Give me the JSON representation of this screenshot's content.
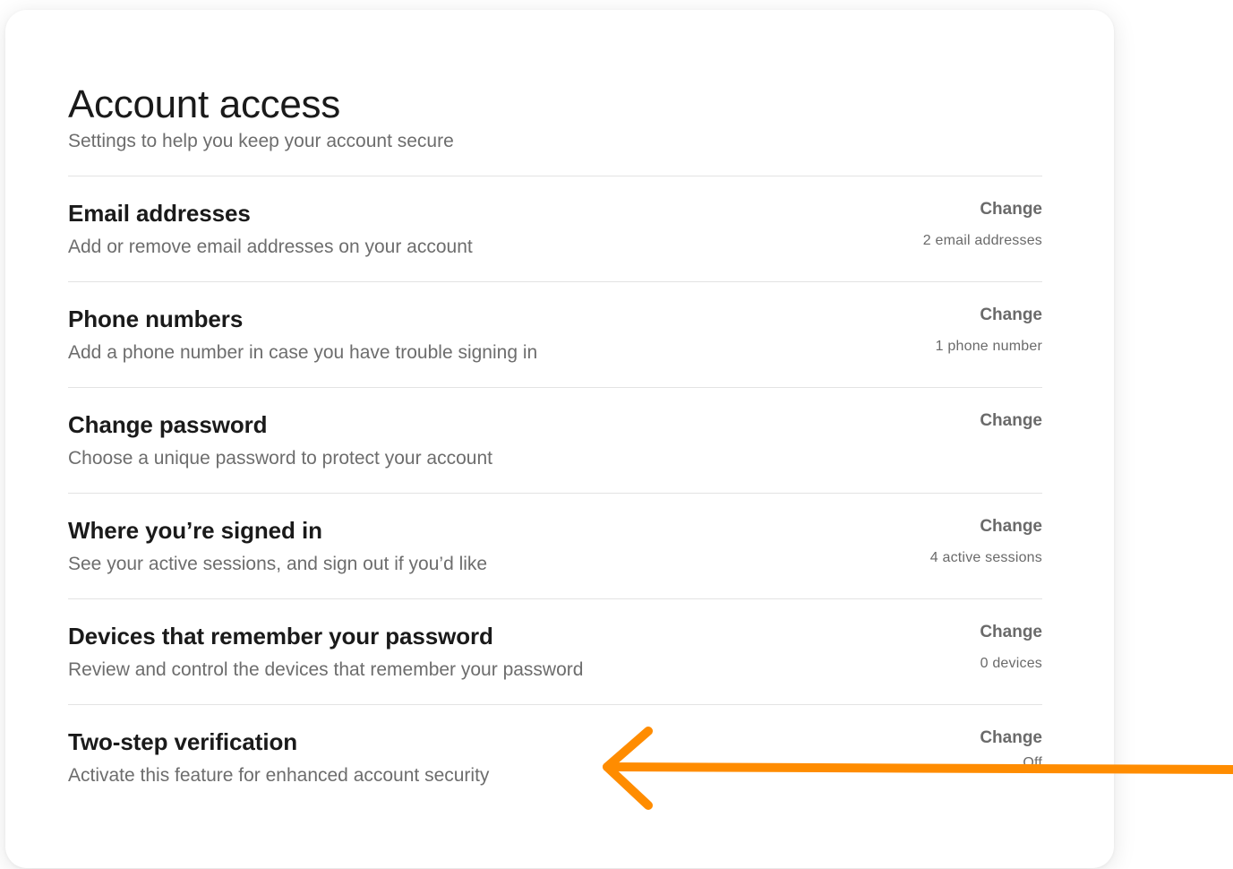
{
  "header": {
    "title": "Account access",
    "subtitle": "Settings to help you keep your account secure"
  },
  "settings": {
    "email": {
      "title": "Email addresses",
      "description": "Add or remove email addresses on your account",
      "action": "Change",
      "status": "2 email addresses"
    },
    "phone": {
      "title": "Phone numbers",
      "description": "Add a phone number in case you have trouble signing in",
      "action": "Change",
      "status": "1 phone number"
    },
    "password": {
      "title": "Change password",
      "description": "Choose a unique password to protect your account",
      "action": "Change"
    },
    "sessions": {
      "title": "Where you’re signed in",
      "description": "See your active sessions, and sign out if you’d like",
      "action": "Change",
      "status": "4 active sessions"
    },
    "devices": {
      "title": "Devices that remember your password",
      "description": "Review and control the devices that remember your password",
      "action": "Change",
      "status": "0 devices"
    },
    "two_step": {
      "title": "Two-step verification",
      "description": "Activate this feature for enhanced account security",
      "action": "Change",
      "status": "Off"
    }
  },
  "annotation": {
    "icon": "arrow-left-icon",
    "color": "#FF8C00"
  }
}
